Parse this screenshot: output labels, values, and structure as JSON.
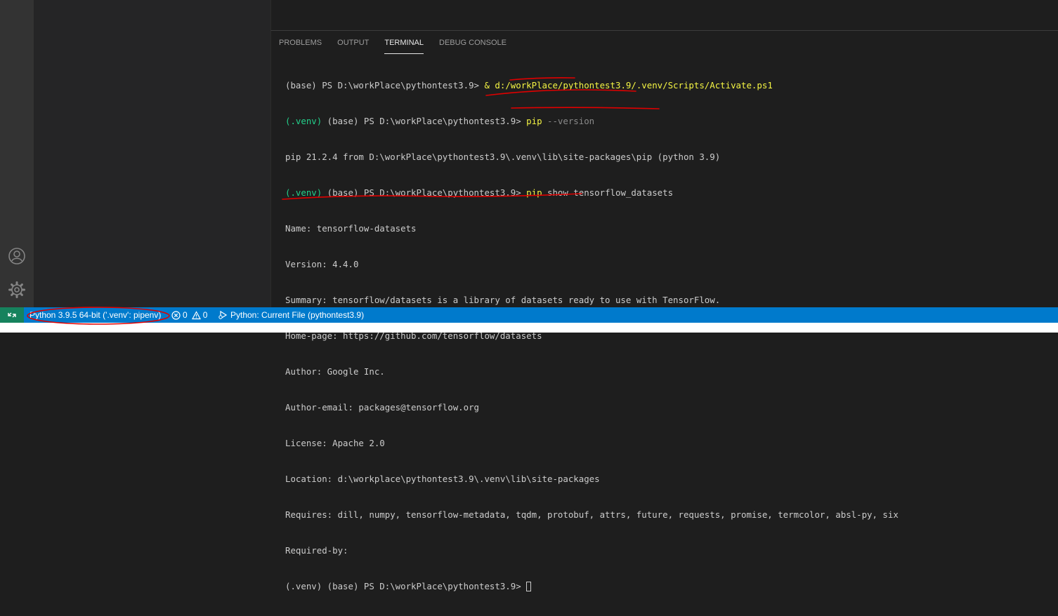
{
  "activity_bar": {
    "icons": [
      "account-icon",
      "gear-icon"
    ]
  },
  "panel": {
    "tabs": [
      {
        "label": "PROBLEMS",
        "active": false
      },
      {
        "label": "OUTPUT",
        "active": false
      },
      {
        "label": "TERMINAL",
        "active": true
      },
      {
        "label": "DEBUG CONSOLE",
        "active": false
      }
    ]
  },
  "terminal": {
    "line1": {
      "prompt": "(base) PS D:\\workPlace\\pythontest3.9> ",
      "amp": "& ",
      "cmd": "d:/workPlace/pythontest3.9/.venv/Scripts/Activate.ps1"
    },
    "line2": {
      "venv": "(.venv)",
      "prompt": " (base) PS D:\\workPlace\\pythontest3.9> ",
      "cmd": "pip",
      "arg": " --version"
    },
    "line3": "pip 21.2.4 from D:\\workPlace\\pythontest3.9\\.venv\\lib\\site-packages\\pip (python 3.9)",
    "line4": {
      "venv": "(.venv)",
      "prompt": " (base) PS D:\\workPlace\\pythontest3.9> ",
      "cmd": "pip",
      "arg": " show tensorflow_datasets"
    },
    "output": [
      "Name: tensorflow-datasets",
      "Version: 4.4.0",
      "Summary: tensorflow/datasets is a library of datasets ready to use with TensorFlow.",
      "Home-page: https://github.com/tensorflow/datasets",
      "Author: Google Inc.",
      "Author-email: packages@tensorflow.org",
      "License: Apache 2.0",
      "Location: d:\\workplace\\pythontest3.9\\.venv\\lib\\site-packages",
      "Requires: dill, numpy, tensorflow-metadata, tqdm, protobuf, attrs, future, requests, promise, termcolor, absl-py, six",
      "Required-by:"
    ],
    "last": {
      "venv": "(.venv)",
      "prompt": " (base) PS D:\\workPlace\\pythontest3.9> "
    }
  },
  "status_bar": {
    "remote_icon": "remote-icon",
    "interpreter": "Python 3.9.5 64-bit ('.venv': pipenv)",
    "errors": "0",
    "warnings": "0",
    "run_config": "Python: Current File (pythontest3.9)",
    "colors": {
      "background": "#007acc",
      "remote": "#16825d"
    }
  },
  "annotation_color": "#e00000"
}
